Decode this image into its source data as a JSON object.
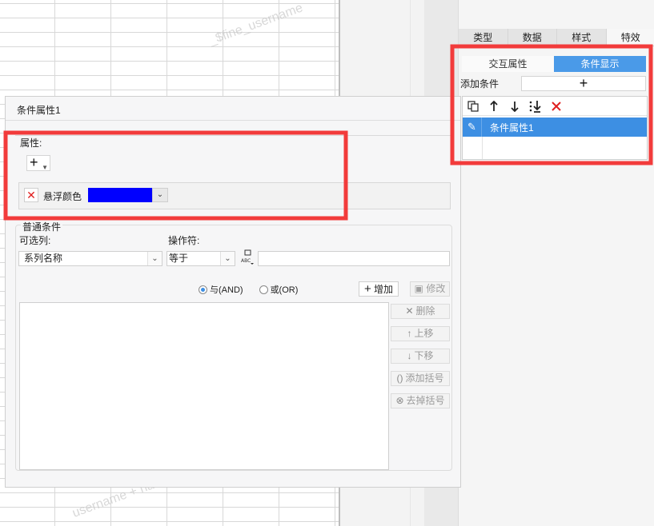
{
  "watermarks": [
    "_$fine_username",
    "username + ha"
  ],
  "right_panel": {
    "tabs": [
      {
        "label": "类型",
        "active": false
      },
      {
        "label": "数据",
        "active": false
      },
      {
        "label": "样式",
        "active": false
      },
      {
        "label": "特效",
        "active": true
      }
    ],
    "subtabs": [
      {
        "label": "交互属性",
        "active": false
      },
      {
        "label": "条件显示",
        "active": true
      }
    ],
    "add_condition_label": "添加条件",
    "add_condition_button": "+",
    "toolbar_icons": [
      "copy-icon",
      "arrow-up-icon",
      "arrow-down-icon",
      "move-bottom-icon",
      "delete-icon"
    ],
    "condition_items": [
      {
        "label": "条件属性1",
        "selected": true
      }
    ]
  },
  "dialog": {
    "title": "条件属性1",
    "properties_label": "属性:",
    "add_property_button": "+",
    "property": {
      "name": "悬浮颜色",
      "color": "#0000ff"
    },
    "normal_condition_label": "普通条件",
    "column_label": "可选列:",
    "operator_label": "操作符:",
    "column_value": "系列名称",
    "operator_value": "等于",
    "value_input": "",
    "logic_options": [
      {
        "label": "与(AND)",
        "checked": true
      },
      {
        "label": "或(OR)",
        "checked": false
      }
    ],
    "add_button": "增加",
    "edit_button": "修改",
    "side_buttons": [
      {
        "icon": "✕",
        "label": "删除"
      },
      {
        "icon": "↑",
        "label": "上移"
      },
      {
        "icon": "↓",
        "label": "下移"
      },
      {
        "icon": "()",
        "label": "添加括号"
      },
      {
        "icon": "⊗",
        "label": "去掉括号"
      }
    ]
  }
}
